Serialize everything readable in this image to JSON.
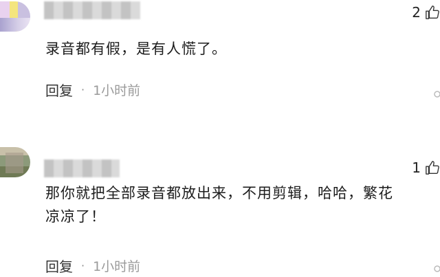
{
  "comments": [
    {
      "likes": "2",
      "text": "录音都有假，是有人慌了。",
      "reply_label": "回复",
      "separator": "·",
      "time": "1小时前"
    },
    {
      "likes": "1",
      "text": "那你就把全部录音都放出来，不用剪辑，哈哈，繁花\n凉凉了！",
      "reply_label": "回复",
      "separator": "·",
      "time": "1小时前"
    }
  ],
  "icons": {
    "like": "thumbs-up-icon",
    "avatar": "avatar"
  }
}
